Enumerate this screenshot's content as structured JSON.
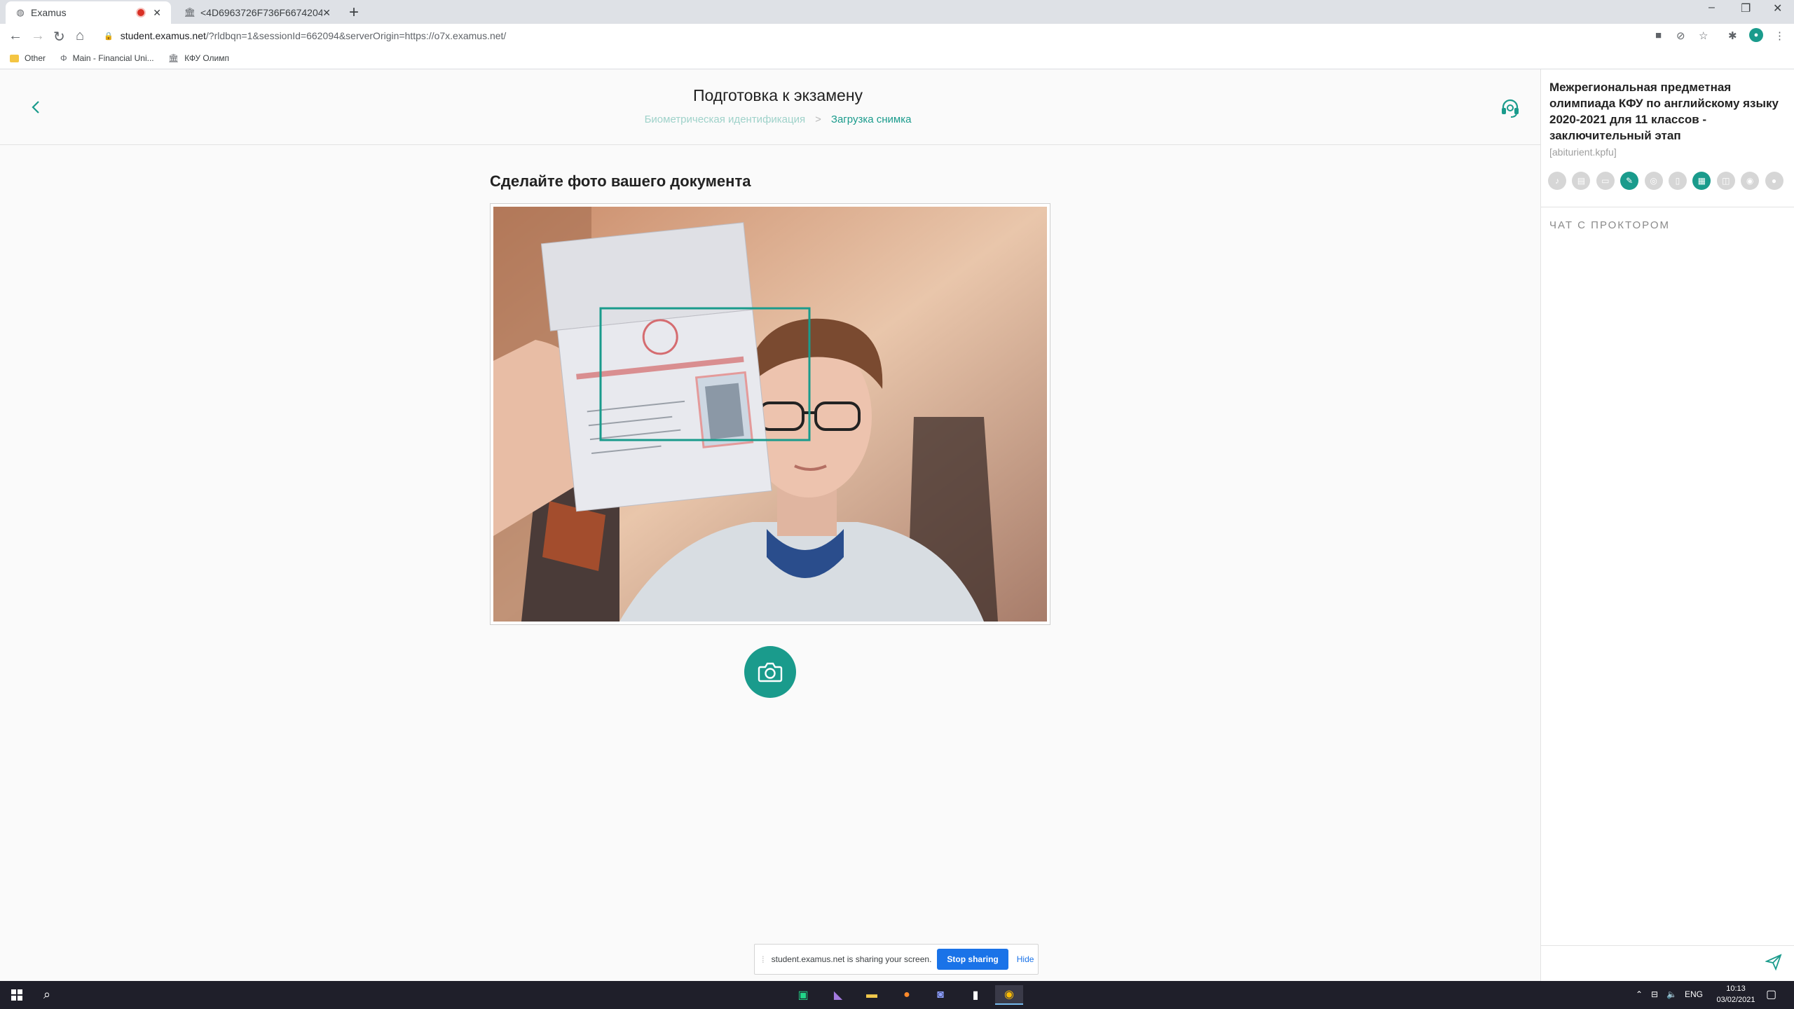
{
  "browser": {
    "tabs": [
      {
        "title": "Examus",
        "recording": true
      },
      {
        "title": "<4D6963726F736F6674204"
      }
    ],
    "url_host": "student.examus.net",
    "url_rest": "/?rldbqn=1&sessionId=662094&serverOrigin=https://o7x.examus.net/",
    "bookmarks": [
      "Other",
      "Main - Financial Uni...",
      "КФУ Олимп"
    ]
  },
  "header": {
    "title": "Подготовка к экзамену",
    "breadcrumb": [
      "Биометрическая идентификация",
      "Загрузка снимка"
    ]
  },
  "main": {
    "heading": "Сделайте фото вашего документа"
  },
  "sidebar": {
    "exam_title": "Межрегиональная предметная олимпиада КФУ по английскому языку 2020-2021 для 11 классов - заключительный этап",
    "organization": "[abiturient.kpfu]",
    "status_icons": [
      {
        "name": "microphone-icon",
        "active": false
      },
      {
        "name": "book-icon",
        "active": false
      },
      {
        "name": "id-card-icon",
        "active": false
      },
      {
        "name": "edit-icon",
        "active": true
      },
      {
        "name": "globe-icon",
        "active": false
      },
      {
        "name": "phone-icon",
        "active": false
      },
      {
        "name": "calculator-icon",
        "active": false
      },
      {
        "name": "chat-icon",
        "active": false
      },
      {
        "name": "eye-icon",
        "active": false
      },
      {
        "name": "person-icon",
        "active": false
      }
    ],
    "chat_label": "ЧАТ С ПРОКТОРОМ"
  },
  "sharebar": {
    "message": "student.examus.net is sharing your screen.",
    "stop_label": "Stop sharing",
    "hide_label": "Hide"
  },
  "taskbar": {
    "lang": "ENG",
    "time": "10:13",
    "date": "03/02/2021"
  },
  "colors": {
    "accent": "#1a9b8c",
    "accent_light": "#9fd2ca"
  }
}
